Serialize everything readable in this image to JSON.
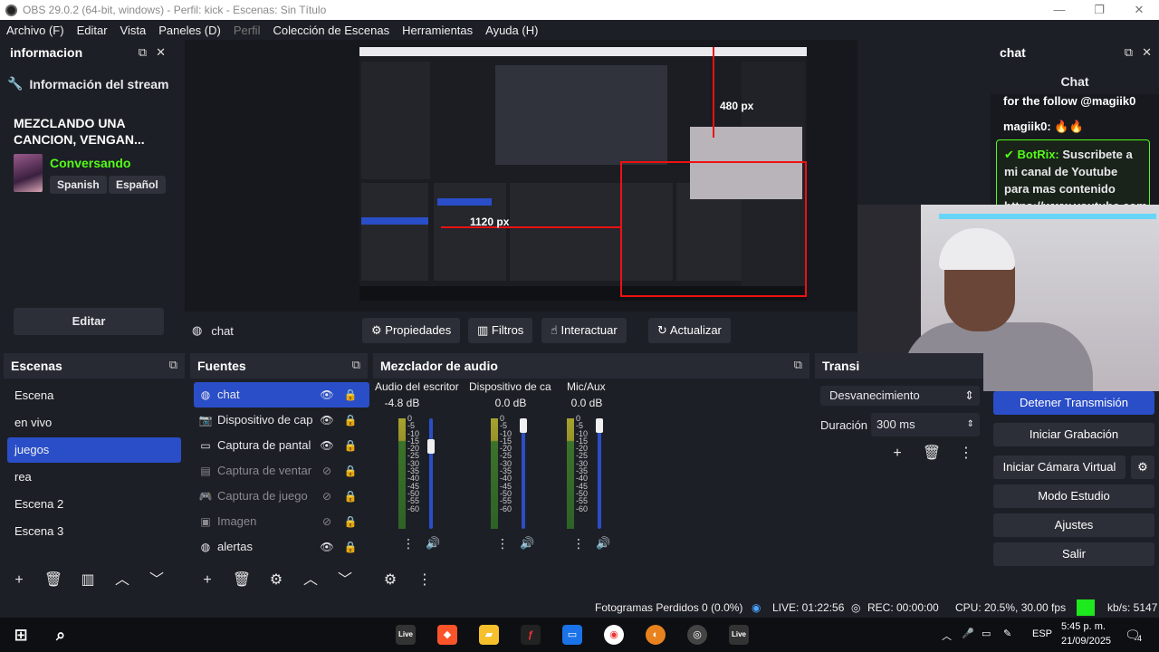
{
  "titlebar": {
    "text": "OBS 29.0.2 (64-bit, windows) - Perfil: kick - Escenas: Sin Título",
    "minimize": "—",
    "restore": "❐",
    "close": "✕"
  },
  "menu": [
    "Archivo (F)",
    "Editar",
    "Vista",
    "Paneles (D)",
    "Perfil",
    "Colección de Escenas",
    "Herramientas",
    "Ayuda (H)"
  ],
  "info_panel": {
    "title": "informacion",
    "subtitle": "Información del stream",
    "stream_title": "MEZCLANDO UNA CANCION, VENGAN...",
    "category": "Conversando",
    "tags": [
      "Spanish",
      "Español"
    ],
    "edit_label": "Editar"
  },
  "preview": {
    "label_480": "480 px",
    "label_1120": "1120 px"
  },
  "source_toolbar": {
    "current_source": "chat",
    "buttons": [
      "Propiedades",
      "Filtros",
      "Interactuar",
      "Actualizar"
    ]
  },
  "chat_panel": {
    "title": "chat",
    "header": "Chat",
    "messages": [
      "for the follow @magiik0",
      "magiik0: 🔥🔥"
    ],
    "botrix_name": "BotRix:",
    "botrix_text": "Suscribete a mi canal de Youtube para mas contenido https://www.youtube.com"
  },
  "scenes": {
    "title": "Escenas",
    "items": [
      "Escena",
      "en vivo",
      "juegos",
      "rea",
      "Escena 2",
      "Escena 3"
    ],
    "selected_index": 2
  },
  "sources": {
    "title": "Fuentes",
    "items": [
      {
        "name": "chat",
        "visible": true,
        "selected": true
      },
      {
        "name": "Dispositivo de cap",
        "visible": true,
        "selected": false
      },
      {
        "name": "Captura de pantal",
        "visible": true,
        "selected": false
      },
      {
        "name": "Captura de ventar",
        "visible": false,
        "selected": false
      },
      {
        "name": "Captura de juego",
        "visible": false,
        "selected": false
      },
      {
        "name": "Imagen",
        "visible": false,
        "selected": false
      },
      {
        "name": "alertas",
        "visible": true,
        "selected": false
      }
    ]
  },
  "mixer": {
    "title": "Mezclador de audio",
    "channels": [
      {
        "name": "Audio del escritor",
        "db": "-4.8 dB",
        "level": 0.78
      },
      {
        "name": "Dispositivo de ca",
        "db": "0.0 dB",
        "level": 1.0
      },
      {
        "name": "Mic/Aux",
        "db": "0.0 dB",
        "level": 1.0
      }
    ],
    "scale": [
      "0",
      "-5",
      "-10",
      "-15",
      "-20",
      "-25",
      "-30",
      "-35",
      "-40",
      "-45",
      "-50",
      "-55",
      "-60"
    ]
  },
  "transitions": {
    "title": "Transi",
    "selected": "Desvanecimiento",
    "duration_label": "Duración",
    "duration_value": "300 ms"
  },
  "controls": {
    "stop_stream": "Detener Transmisión",
    "start_recording": "Iniciar Grabación",
    "start_virtual_cam": "Iniciar Cámara Virtual",
    "studio_mode": "Modo Estudio",
    "settings": "Ajustes",
    "exit": "Salir"
  },
  "status": {
    "dropped": "Fotogramas Perdidos 0 (0.0%)",
    "live": "LIVE: 01:22:56",
    "rec": "REC: 00:00:00",
    "cpu": "CPU: 20.5%, 30.00 fps",
    "kbs": "kb/s: 5147"
  },
  "taskbar": {
    "lang": "ESP",
    "time": "5:45 p. m.",
    "date": "21/09/2025",
    "notif_count": "4",
    "live_icon": "Live"
  },
  "colors": {
    "accent": "#2a4ec8",
    "kick_green": "#53fc18",
    "bg": "#1d1f26"
  }
}
